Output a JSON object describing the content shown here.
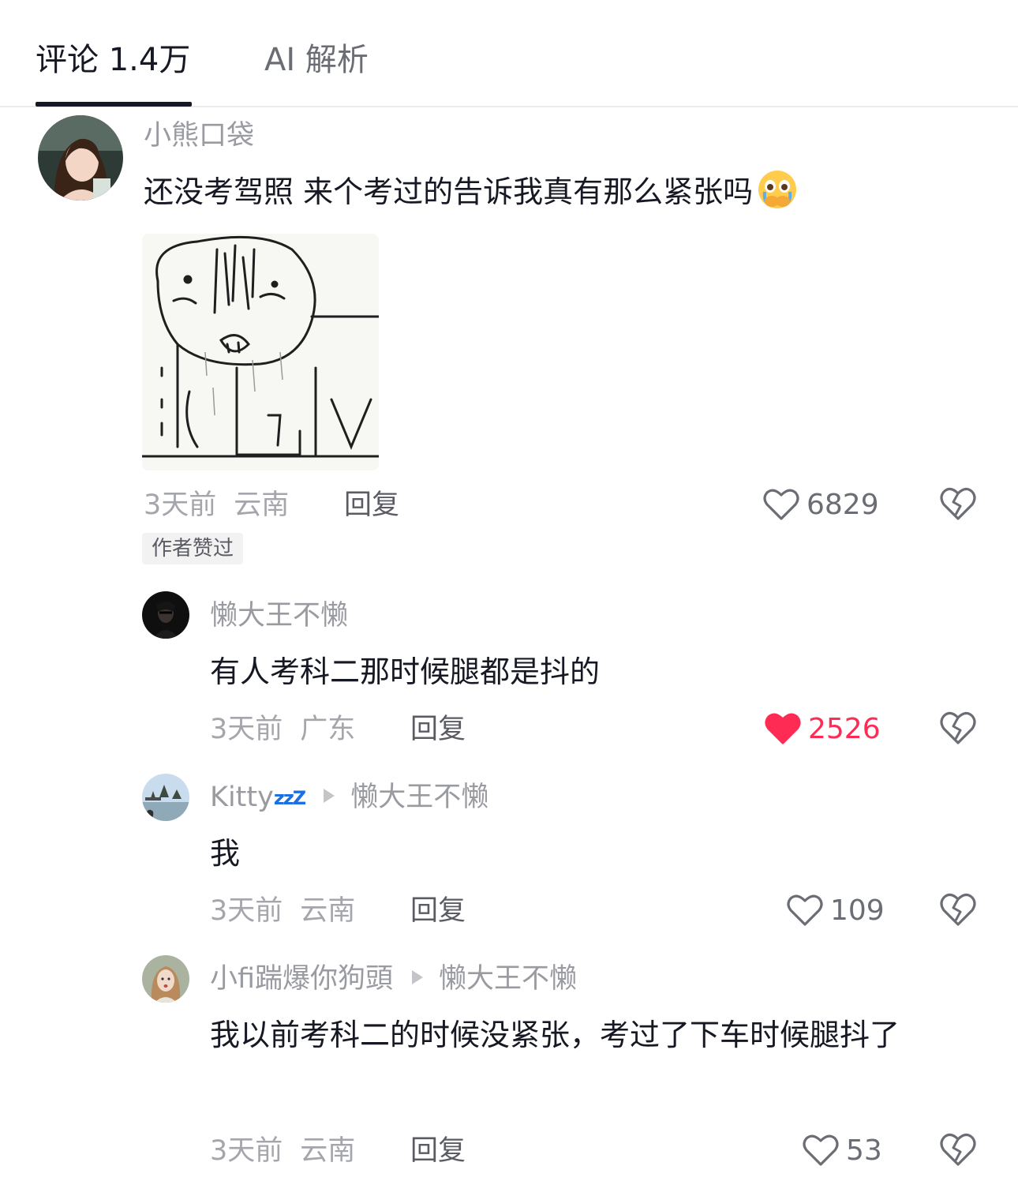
{
  "tabs": {
    "comments": "评论 1.4万",
    "ai": "AI 解析"
  },
  "badge_author_liked": "作者赞过",
  "reply_label": "回复",
  "icons": {
    "like": "heart-outline-icon",
    "liked": "heart-filled-icon",
    "dislike": "broken-heart-icon"
  },
  "colors": {
    "liked": "#fe2c55",
    "text": "#161823",
    "muted": "#9a9ba1"
  },
  "comments": [
    {
      "username": "小熊口袋",
      "text": "还没考驾照 来个考过的告诉我真有那么紧张吗",
      "emoji": "crying-face-emoji",
      "time": "3天前",
      "location": "云南",
      "likes": "6829",
      "liked": false
    },
    {
      "username": "懒大王不懒",
      "text": "有人考科二那时候腿都是抖的",
      "time": "3天前",
      "location": "广东",
      "likes": "2526",
      "liked": true
    },
    {
      "username": "Kitty",
      "username_suffix": "zzZ",
      "reply_to": "懒大王不懒",
      "text": "我",
      "time": "3天前",
      "location": "云南",
      "likes": "109",
      "liked": false
    },
    {
      "username": "小fi踹爆你狗頭",
      "reply_to": "懒大王不懒",
      "text": "我以前考科二的时候没紧张，考过了下车时候腿抖了",
      "time": "3天前",
      "location": "云南",
      "likes": "53",
      "liked": false
    }
  ]
}
